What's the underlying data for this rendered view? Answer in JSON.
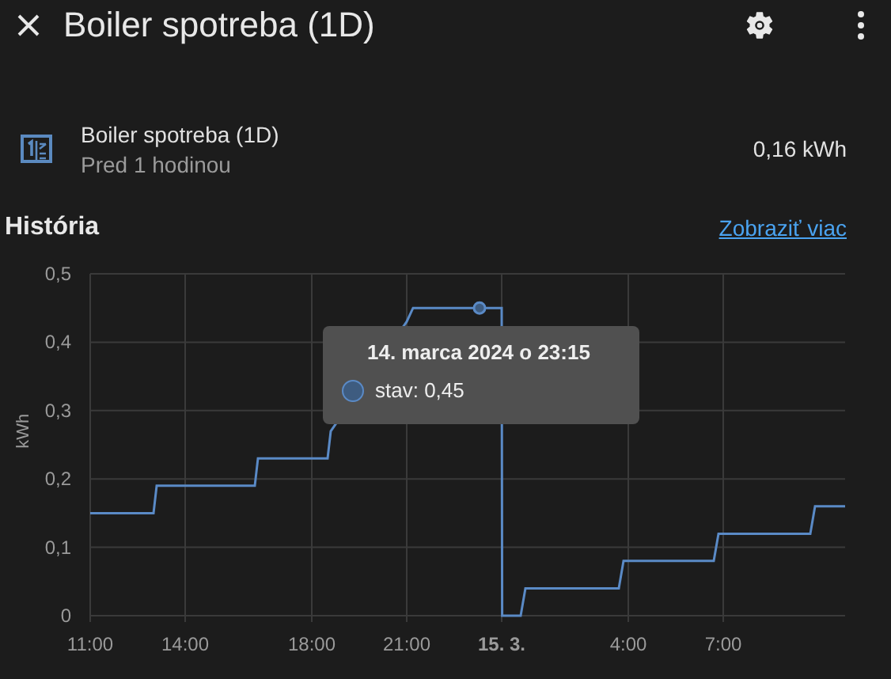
{
  "dialog": {
    "title": "Boiler spotreba (1D)"
  },
  "entity": {
    "name": "Boiler spotreba (1D)",
    "last_changed": "Pred 1 hodinou",
    "state": "0,16 kWh"
  },
  "history": {
    "title": "História",
    "link": "Zobraziť viac",
    "chart_data": {
      "type": "line",
      "ylabel": "kWh",
      "grid": true,
      "xlim": [
        "2024-03-14T11:00",
        "2024-03-15T10:51"
      ],
      "ylim": [
        0,
        0.5
      ],
      "xticks": [
        {
          "value": "2024-03-14T11:00",
          "label": "11:00"
        },
        {
          "value": "2024-03-14T14:00",
          "label": "14:00"
        },
        {
          "value": "2024-03-14T18:00",
          "label": "18:00"
        },
        {
          "value": "2024-03-14T21:00",
          "label": "21:00"
        },
        {
          "value": "2024-03-15T00:00",
          "label": "15. 3."
        },
        {
          "value": "2024-03-15T04:00",
          "label": "4:00"
        },
        {
          "value": "2024-03-15T07:00",
          "label": "7:00"
        }
      ],
      "yticks": [
        {
          "value": 0,
          "label": "0"
        },
        {
          "value": 0.1,
          "label": "0,1"
        },
        {
          "value": 0.2,
          "label": "0,2"
        },
        {
          "value": 0.3,
          "label": "0,3"
        },
        {
          "value": 0.4,
          "label": "0,4"
        },
        {
          "value": 0.5,
          "label": "0,5"
        }
      ],
      "x": [
        "2024-03-14T11:00",
        "2024-03-14T13:00",
        "2024-03-14T13:06",
        "2024-03-14T16:12",
        "2024-03-14T16:18",
        "2024-03-14T18:30",
        "2024-03-14T18:36",
        "2024-03-14T21:00",
        "2024-03-14T21:12",
        "2024-03-15T00:00",
        "2024-03-15T00:01",
        "2024-03-15T00:36",
        "2024-03-15T00:45",
        "2024-03-15T03:42",
        "2024-03-15T03:51",
        "2024-03-15T06:42",
        "2024-03-15T06:51",
        "2024-03-15T09:45",
        "2024-03-15T09:54",
        "2024-03-15T10:51"
      ],
      "series": [
        {
          "color": "#5a8ac6",
          "values": [
            0.15,
            0.15,
            0.19,
            0.19,
            0.23,
            0.23,
            0.27,
            0.43,
            0.45,
            0.45,
            0,
            0,
            0.04,
            0.04,
            0.08,
            0.08,
            0.12,
            0.12,
            0.16,
            0.16
          ]
        }
      ]
    },
    "tooltip": {
      "title": "14. marca 2024 o 23:15",
      "text": "stav: 0,45"
    }
  }
}
